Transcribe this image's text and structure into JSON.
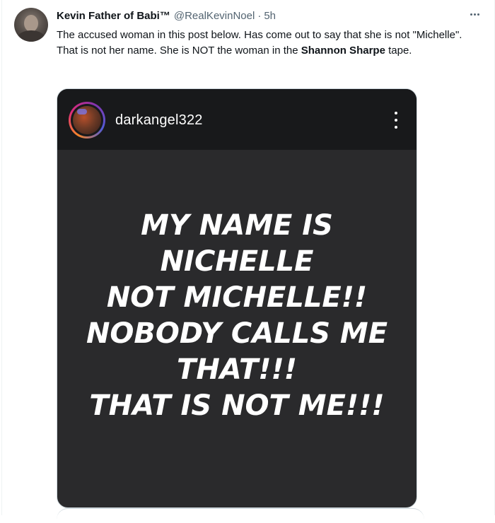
{
  "tweet": {
    "author_name": "Kevin Father of Babi™",
    "handle": "@RealKevinNoel",
    "separator": "·",
    "timestamp": "5h",
    "text_part1": "The accused woman in this post below. Has come out to say that she is not \"Michelle\". That is not her name. She is NOT the woman in the ",
    "mention": "Shannon Sharpe",
    "text_part2": " tape.",
    "more_icon": "more-horizontal-icon",
    "avatar_icon": "profile-photo"
  },
  "embedded_post": {
    "username": "darkangel322",
    "more_icon": "more-vertical-icon",
    "background": "#2a2a2c",
    "header_background": "#18191b",
    "statement_lines": [
      "MY NAME IS",
      "NICHELLE",
      "NOT MICHELLE!!",
      "NOBODY CALLS ME",
      "THAT!!!",
      "THAT IS NOT ME!!!"
    ]
  }
}
